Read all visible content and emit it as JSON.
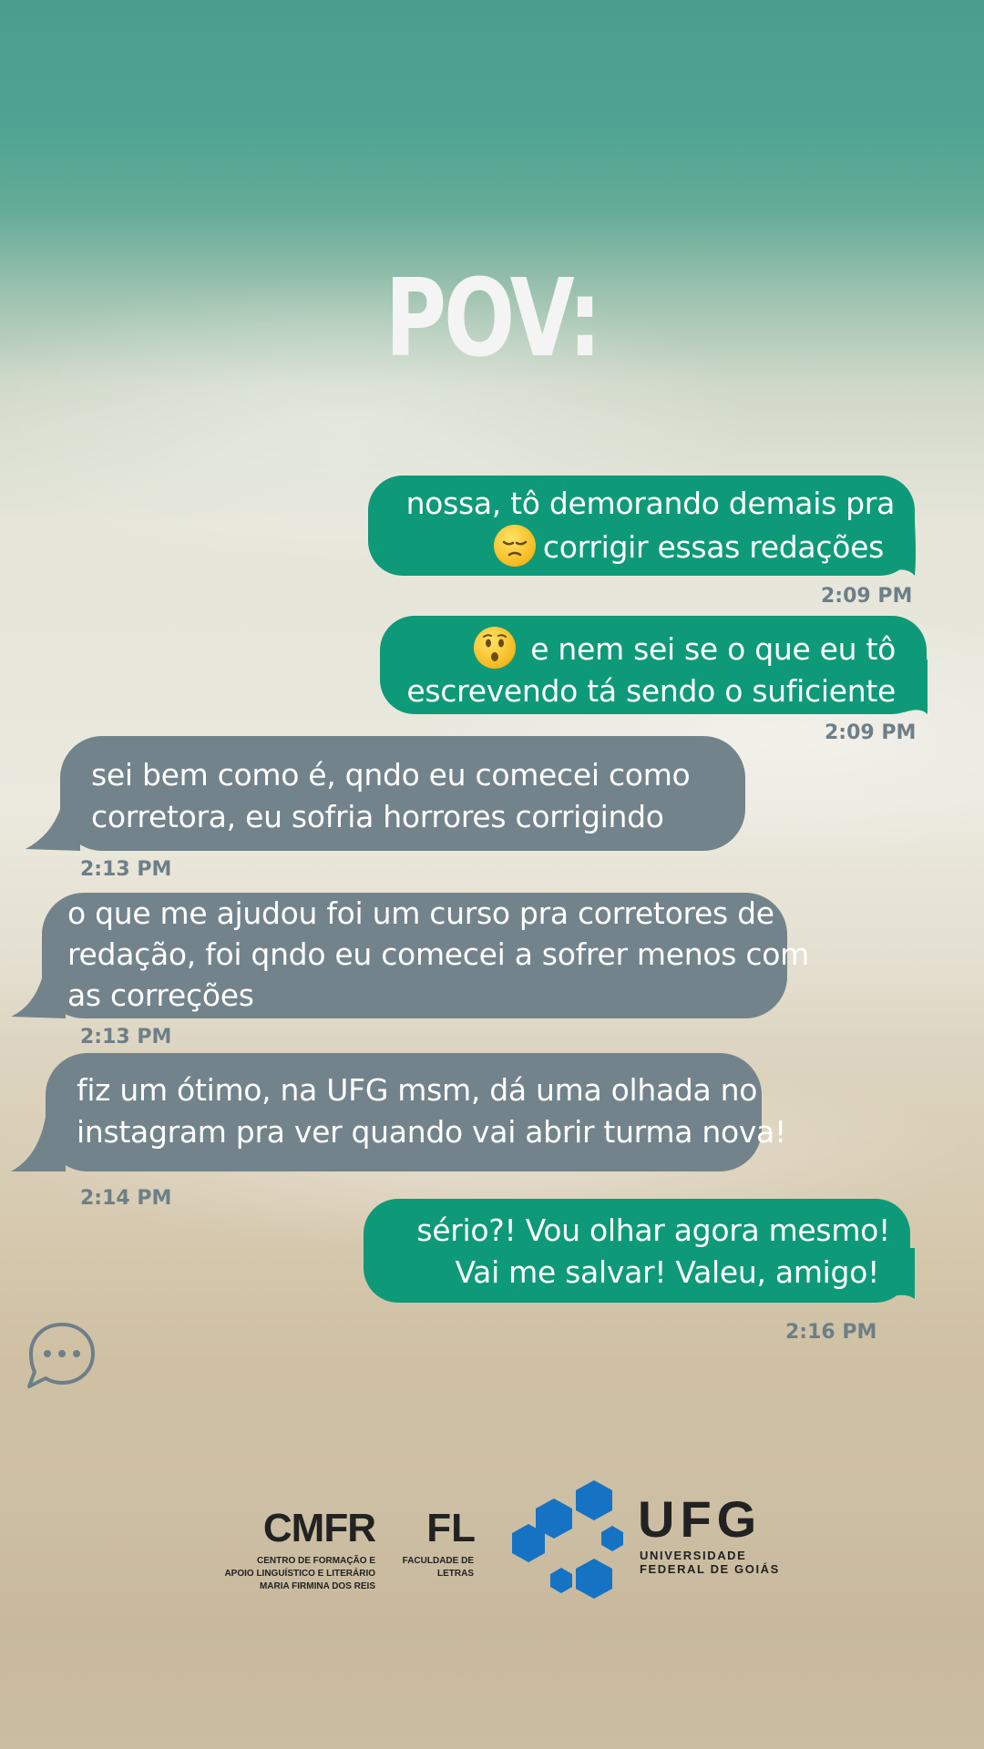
{
  "title": "POV:",
  "messages": [
    {
      "lines": [
        "nossa, tô demorando demais pra",
        "corrigir essas redações"
      ],
      "time": "2:09 PM",
      "emoji": "pensive-face"
    },
    {
      "lines": [
        "e nem sei se o que eu tô",
        "escrevendo tá sendo o suficiente"
      ],
      "time": "2:09 PM",
      "emoji": "hushed-face"
    },
    {
      "lines": [
        "sei bem como é, qndo eu comecei como",
        "corretora, eu sofria horrores corrigindo"
      ],
      "time": "2:13 PM"
    },
    {
      "lines": [
        "o que me ajudou foi um curso pra corretores de",
        "redação, foi qndo eu comecei a sofrer menos com",
        "as correções"
      ],
      "time": "2:13 PM"
    },
    {
      "lines": [
        "fiz um ótimo, na UFG msm, dá uma olhada no",
        "instagram pra ver quando vai abrir turma nova!"
      ],
      "time": "2:14 PM"
    },
    {
      "lines": [
        "sério?! Vou olhar agora mesmo!",
        "Vai me salvar! Valeu, amigo!"
      ],
      "time": "2:16 PM"
    }
  ],
  "logos": {
    "cmfr": {
      "acronym": "CMFR",
      "lines": [
        "CENTRO DE FORMAÇÃO E",
        "APOIO LINGUÍSTICO E LITERÁRIO",
        "MARIA FIRMINA DOS REIS"
      ]
    },
    "fl": {
      "acronym": "FL",
      "lines": [
        "FACULDADE DE",
        "LETRAS"
      ]
    },
    "ufg": {
      "acronym": "UFG",
      "lines": [
        "UNIVERSIDADE",
        "FEDERAL DE GOIÁS"
      ]
    }
  },
  "colors": {
    "sent_bubble": "#0e9a78",
    "received_bubble": "#72838b",
    "timestamp": "#6d7f88",
    "ufg_blue": "#1673c4"
  }
}
